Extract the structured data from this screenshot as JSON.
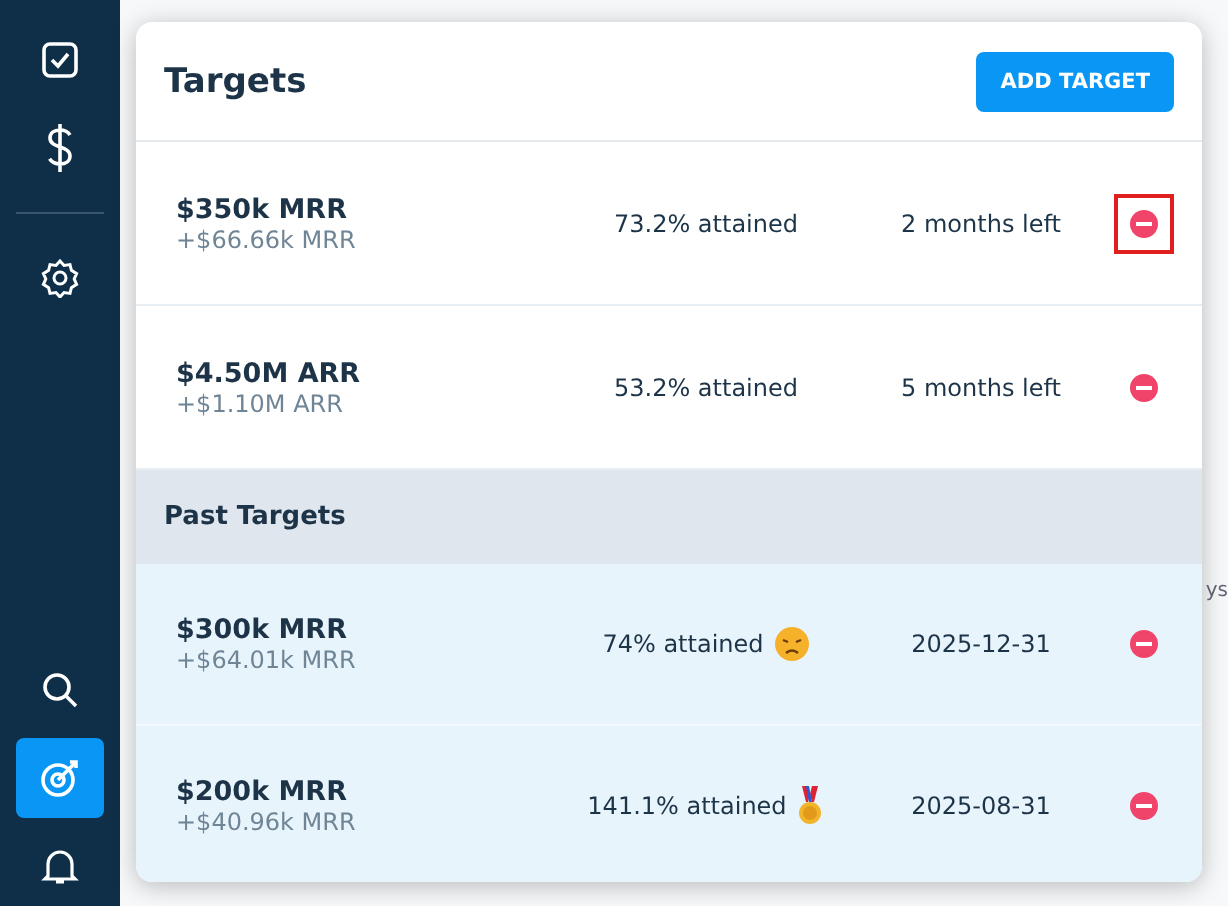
{
  "sidebar": {
    "items": [
      {
        "kind": "tasks",
        "selected": false
      },
      {
        "kind": "revenue",
        "selected": false
      },
      {
        "kind": "settings",
        "selected": false
      },
      {
        "kind": "search",
        "selected": false
      },
      {
        "kind": "targets",
        "selected": true
      },
      {
        "kind": "notifications",
        "selected": false
      }
    ]
  },
  "background": {
    "cut_caption": "ys"
  },
  "targets_panel": {
    "title": "Targets",
    "add_button": "ADD TARGET",
    "current": [
      {
        "goal": "$350k MRR",
        "delta": "+$66.66k MRR",
        "attained": "73.2% attained",
        "remaining": "2 months left",
        "highlighted": true
      },
      {
        "goal": "$4.50M ARR",
        "delta": "+$1.10M ARR",
        "attained": "53.2% attained",
        "remaining": "5 months left",
        "highlighted": false
      }
    ],
    "past_title": "Past Targets",
    "past": [
      {
        "goal": "$300k MRR",
        "delta": "+$64.01k MRR",
        "attained": "74% attained",
        "kind": "missed",
        "date": "2025-12-31",
        "highlighted": false
      },
      {
        "goal": "$200k MRR",
        "delta": "+$40.96k MRR",
        "attained": "141.1% attained",
        "kind": "exceeded",
        "date": "2025-08-31",
        "highlighted": false
      }
    ]
  }
}
